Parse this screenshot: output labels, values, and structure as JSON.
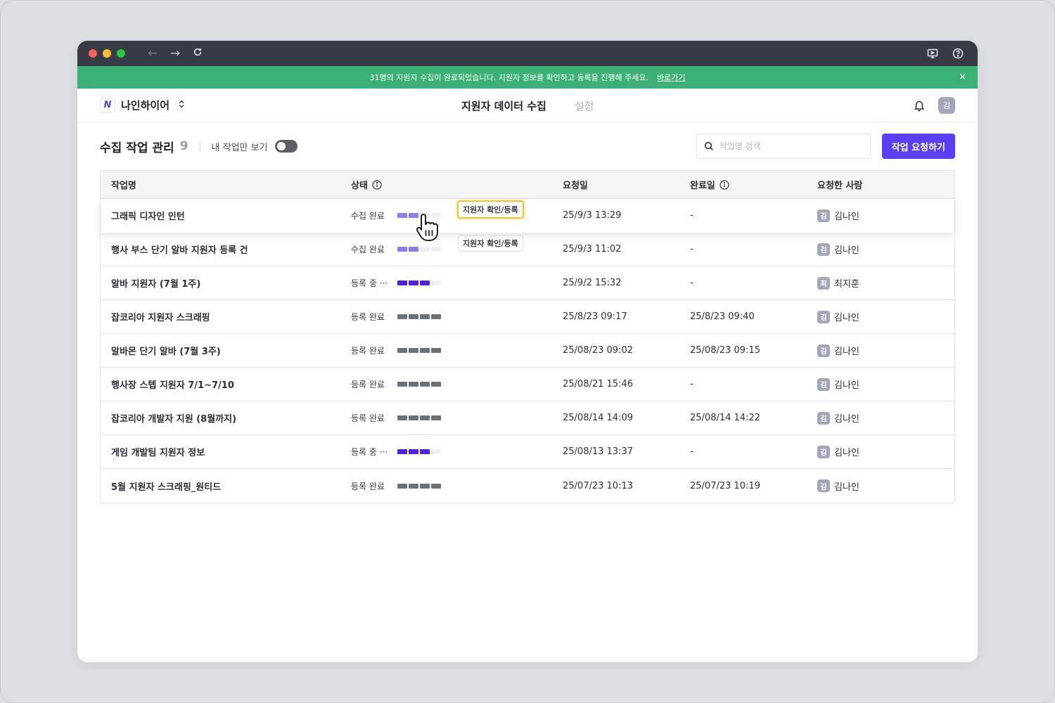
{
  "browser": {
    "back_icon": "arrow-left-icon",
    "forward_icon": "arrow-right-icon",
    "reload_icon": "refresh-icon"
  },
  "banner": {
    "message": "31명의 지원자 수집이 완료되었습니다. 지원자 정보를 확인하고 등록을 진행해 주세요.",
    "link": "바로가기",
    "close": "×",
    "color": "#3bb273"
  },
  "app": {
    "workspace": "나인하이어",
    "logo_letter": "N",
    "nav": [
      "지원자 데이터 수집",
      "설정"
    ],
    "user_initial": "김"
  },
  "toolbar": {
    "title": "수집 작업 관리",
    "count": "9",
    "toggle_label": "내 작업만 보기",
    "toggle_on": false,
    "search_placeholder": "작업명 검색",
    "primary_button": "작업 요청하기",
    "accent": "#5b3ff5"
  },
  "table": {
    "headers": [
      "작업명",
      "상태",
      "요청일",
      "완료일",
      "요청한 사람"
    ],
    "action_label": "지원자 확인/등록",
    "rows": [
      {
        "name": "그래픽 디자인 인턴",
        "status": "수집 완료",
        "progress": "collect",
        "requested": "25/9/3 13:29",
        "completed": "-",
        "user_initial": "김",
        "user": "김나인"
      },
      {
        "name": "행사 부스 단기 알바 지원자 등록 건",
        "status": "수집 완료",
        "progress": "collect",
        "requested": "25/9/3 11:02",
        "completed": "-",
        "user_initial": "김",
        "user": "김나인"
      },
      {
        "name": "알바 지원자 (7월 1주)",
        "status": "등록 중 ···",
        "progress": "registering",
        "requested": "25/9/2 15:32",
        "completed": "-",
        "user_initial": "최",
        "user": "최지훈"
      },
      {
        "name": "잡코리아 지원자 스크래핑",
        "status": "등록 완료",
        "progress": "done",
        "requested": "25/8/23 09:17",
        "completed": "25/8/23 09:40",
        "user_initial": "김",
        "user": "김나인"
      },
      {
        "name": "알바몬 단기 알바 (7월 3주)",
        "status": "등록 완료",
        "progress": "done",
        "requested": "25/08/23 09:02",
        "completed": "25/08/23 09:15",
        "user_initial": "김",
        "user": "김나인"
      },
      {
        "name": "행사장 스텝 지원자 7/1~7/10",
        "status": "등록 완료",
        "progress": "done",
        "requested": "25/08/21 15:46",
        "completed": "-",
        "user_initial": "김",
        "user": "김나인"
      },
      {
        "name": "잡코리아 개발자 지원 (8월까지)",
        "status": "등록 완료",
        "progress": "done",
        "requested": "25/08/14 14:09",
        "completed": "25/08/14 14:22",
        "user_initial": "김",
        "user": "김나인"
      },
      {
        "name": "게임 개발팀 지원자 정보",
        "status": "등록 중 ···",
        "progress": "registering",
        "requested": "25/08/13 13:37",
        "completed": "-",
        "user_initial": "김",
        "user": "김나인"
      },
      {
        "name": "5월 지원자 스크래핑_원티드",
        "status": "등록 완료",
        "progress": "done",
        "requested": "25/07/23 10:13",
        "completed": "25/07/23 10:19",
        "user_initial": "김",
        "user": "김나인"
      }
    ]
  }
}
